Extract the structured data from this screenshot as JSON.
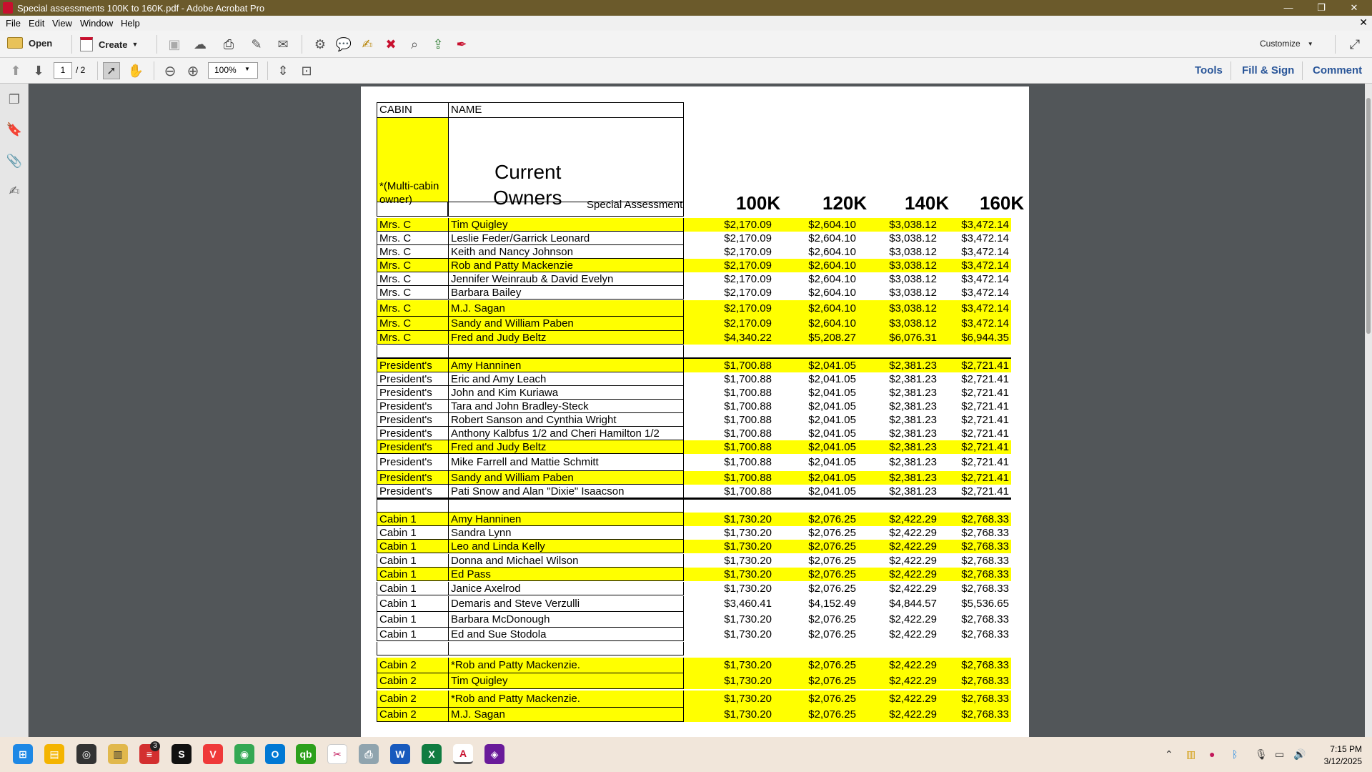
{
  "window": {
    "title": "Special assessments 100K to 160K.pdf - Adobe Acrobat Pro",
    "minimize": "—",
    "restore": "❐",
    "close": "✕",
    "doc_close": "✕"
  },
  "menu": [
    "File",
    "Edit",
    "View",
    "Window",
    "Help"
  ],
  "toolbar": {
    "open": "Open",
    "create": "Create",
    "customize": "Customize"
  },
  "nav": {
    "page": "1",
    "total": "/ 2",
    "zoom": "100%",
    "tools": "Tools",
    "fill_sign": "Fill & Sign",
    "comment": "Comment"
  },
  "header": {
    "cabin": "CABIN",
    "name": "NAME",
    "multi": "*(Multi-cabin owner)",
    "current": "Current",
    "owners": "Owners",
    "special": "Special Assessment",
    "c100": "100K",
    "c120": "120K",
    "c140": "140K",
    "c160": "160K"
  },
  "rows": [
    {
      "cabin": "Mrs. C",
      "name": "Tim Quigley",
      "v": [
        "$2,170.09",
        "$2,604.10",
        "$3,038.12",
        "$3,472.14"
      ],
      "hl": true
    },
    {
      "cabin": "Mrs. C",
      "name": "Leslie Feder/Garrick Leonard",
      "v": [
        "$2,170.09",
        "$2,604.10",
        "$3,038.12",
        "$3,472.14"
      ],
      "hl": false
    },
    {
      "cabin": "Mrs. C",
      "name": "Keith and Nancy Johnson",
      "v": [
        "$2,170.09",
        "$2,604.10",
        "$3,038.12",
        "$3,472.14"
      ],
      "hl": false
    },
    {
      "cabin": "Mrs. C",
      "name": "Rob and Patty Mackenzie",
      "v": [
        "$2,170.09",
        "$2,604.10",
        "$3,038.12",
        "$3,472.14"
      ],
      "hl": true
    },
    {
      "cabin": "Mrs. C",
      "name": "Jennifer Weinraub & David Evelyn",
      "v": [
        "$2,170.09",
        "$2,604.10",
        "$3,038.12",
        "$3,472.14"
      ],
      "hl": false
    },
    {
      "cabin": "Mrs. C",
      "name": "Barbara Bailey",
      "v": [
        "$2,170.09",
        "$2,604.10",
        "$3,038.12",
        "$3,472.14"
      ],
      "hl": false
    },
    {
      "cabin": "Mrs. C",
      "name": "M.J. Sagan",
      "v": [
        "$2,170.09",
        "$2,604.10",
        "$3,038.12",
        "$3,472.14"
      ],
      "hl": true
    },
    {
      "cabin": "Mrs. C",
      "name": "Sandy and William Paben",
      "v": [
        "$2,170.09",
        "$2,604.10",
        "$3,038.12",
        "$3,472.14"
      ],
      "hl": true
    },
    {
      "cabin": "Mrs. C",
      "name": "Fred and Judy Beltz",
      "v": [
        "$4,340.22",
        "$5,208.27",
        "$6,076.31",
        "$6,944.35"
      ],
      "hl": true
    },
    {
      "cabin": "",
      "name": "",
      "v": [
        "",
        "",
        "",
        ""
      ],
      "hl": false
    },
    {
      "cabin": "President's",
      "name": "Amy Hanninen",
      "v": [
        "$1,700.88",
        "$2,041.05",
        "$2,381.23",
        "$2,721.41"
      ],
      "hl": true
    },
    {
      "cabin": "President's",
      "name": "Eric and Amy Leach",
      "v": [
        "$1,700.88",
        "$2,041.05",
        "$2,381.23",
        "$2,721.41"
      ],
      "hl": false
    },
    {
      "cabin": "President's",
      "name": "John and Kim Kuriawa",
      "v": [
        "$1,700.88",
        "$2,041.05",
        "$2,381.23",
        "$2,721.41"
      ],
      "hl": false
    },
    {
      "cabin": "President's",
      "name": "Tara and John Bradley-Steck",
      "v": [
        "$1,700.88",
        "$2,041.05",
        "$2,381.23",
        "$2,721.41"
      ],
      "hl": false
    },
    {
      "cabin": "President's",
      "name": "Robert Sanson and Cynthia Wright",
      "v": [
        "$1,700.88",
        "$2,041.05",
        "$2,381.23",
        "$2,721.41"
      ],
      "hl": false
    },
    {
      "cabin": "President's",
      "name": "Anthony Kalbfus  1/2 and Cheri Hamilton 1/2",
      "v": [
        "$1,700.88",
        "$2,041.05",
        "$2,381.23",
        "$2,721.41"
      ],
      "hl": false
    },
    {
      "cabin": "President's",
      "name": "Fred and Judy Beltz",
      "v": [
        "$1,700.88",
        "$2,041.05",
        "$2,381.23",
        "$2,721.41"
      ],
      "hl": true
    },
    {
      "cabin": "President's",
      "name": "Mike Farrell and Mattie Schmitt",
      "v": [
        "$1,700.88",
        "$2,041.05",
        "$2,381.23",
        "$2,721.41"
      ],
      "hl": false
    },
    {
      "cabin": "President's",
      "name": "Sandy and William Paben",
      "v": [
        "$1,700.88",
        "$2,041.05",
        "$2,381.23",
        "$2,721.41"
      ],
      "hl": true
    },
    {
      "cabin": "President's",
      "name": "Pati Snow and Alan \"Dixie\" Isaacson",
      "v": [
        "$1,700.88",
        "$2,041.05",
        "$2,381.23",
        "$2,721.41"
      ],
      "hl": false
    },
    {
      "cabin": "",
      "name": "",
      "v": [
        "",
        "",
        "",
        ""
      ],
      "hl": false
    },
    {
      "cabin": "Cabin 1",
      "name": "Amy Hanninen",
      "v": [
        "$1,730.20",
        "$2,076.25",
        "$2,422.29",
        "$2,768.33"
      ],
      "hl": true
    },
    {
      "cabin": "Cabin 1",
      "name": "Sandra Lynn",
      "v": [
        "$1,730.20",
        "$2,076.25",
        "$2,422.29",
        "$2,768.33"
      ],
      "hl": false
    },
    {
      "cabin": "Cabin 1",
      "name": "Leo and Linda Kelly",
      "v": [
        "$1,730.20",
        "$2,076.25",
        "$2,422.29",
        "$2,768.33"
      ],
      "hl": true
    },
    {
      "cabin": "Cabin 1",
      "name": "Donna and Michael Wilson",
      "v": [
        "$1,730.20",
        "$2,076.25",
        "$2,422.29",
        "$2,768.33"
      ],
      "hl": false
    },
    {
      "cabin": "Cabin 1",
      "name": "Ed Pass",
      "v": [
        "$1,730.20",
        "$2,076.25",
        "$2,422.29",
        "$2,768.33"
      ],
      "hl": true
    },
    {
      "cabin": "Cabin 1",
      "name": "Janice Axelrod",
      "v": [
        "$1,730.20",
        "$2,076.25",
        "$2,422.29",
        "$2,768.33"
      ],
      "hl": false
    },
    {
      "cabin": "Cabin 1",
      "name": "Demaris and Steve Verzulli",
      "v": [
        "$3,460.41",
        "$4,152.49",
        "$4,844.57",
        "$5,536.65"
      ],
      "hl": false
    },
    {
      "cabin": "Cabin 1",
      "name": "Barbara McDonough",
      "v": [
        "$1,730.20",
        "$2,076.25",
        "$2,422.29",
        "$2,768.33"
      ],
      "hl": false
    },
    {
      "cabin": "Cabin 1",
      "name": "Ed and Sue Stodola",
      "v": [
        "$1,730.20",
        "$2,076.25",
        "$2,422.29",
        "$2,768.33"
      ],
      "hl": false
    },
    {
      "cabin": "",
      "name": "",
      "v": [
        "",
        "",
        "",
        ""
      ],
      "hl": false
    },
    {
      "cabin": "Cabin 2",
      "name": "*Rob and Patty Mackenzie.",
      "v": [
        "$1,730.20",
        "$2,076.25",
        "$2,422.29",
        "$2,768.33"
      ],
      "hl": true
    },
    {
      "cabin": "Cabin 2",
      "name": "Tim Quigley",
      "v": [
        "$1,730.20",
        "$2,076.25",
        "$2,422.29",
        "$2,768.33"
      ],
      "hl": true
    },
    {
      "cabin": "Cabin 2",
      "name": "*Rob and Patty Mackenzie.",
      "v": [
        "$1,730.20",
        "$2,076.25",
        "$2,422.29",
        "$2,768.33"
      ],
      "hl": true
    },
    {
      "cabin": "Cabin 2",
      "name": "M.J. Sagan",
      "v": [
        "$1,730.20",
        "$2,076.25",
        "$2,422.29",
        "$2,768.33"
      ],
      "hl": true
    }
  ],
  "taskbar": {
    "badge": "3",
    "time": "7:15 PM",
    "date": "3/12/2025"
  }
}
